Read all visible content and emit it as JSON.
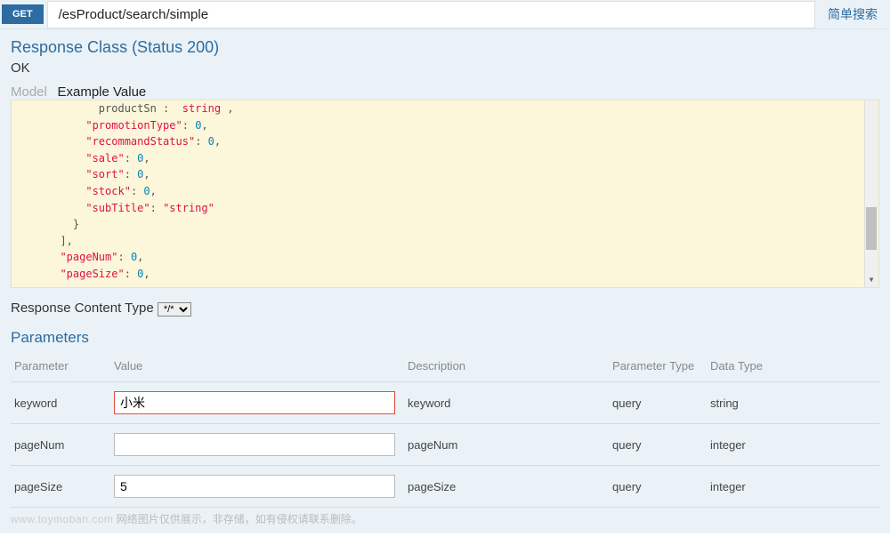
{
  "header": {
    "method": "GET",
    "path": "/esProduct/search/simple",
    "description": "简单搜索"
  },
  "response": {
    "class_label": "Response Class (Status 200)",
    "status_text": "OK"
  },
  "tabs": {
    "model": "Model",
    "example": "Example Value"
  },
  "example_json_prefix": "        productSn : ",
  "example_json": {
    "promotionType": 0,
    "recommandStatus": 0,
    "sale": 0,
    "sort": 0,
    "stock": 0,
    "subTitle": "string",
    "pageNum": 0,
    "pageSize": 0
  },
  "content_type": {
    "label": "Response Content Type",
    "value": "*/* "
  },
  "parameters": {
    "title": "Parameters",
    "headers": {
      "parameter": "Parameter",
      "value": "Value",
      "description": "Description",
      "param_type": "Parameter Type",
      "data_type": "Data Type"
    },
    "rows": [
      {
        "name": "keyword",
        "value": "小米",
        "description": "keyword",
        "param_type": "query",
        "data_type": "string",
        "highlight": true
      },
      {
        "name": "pageNum",
        "value": "",
        "description": "pageNum",
        "param_type": "query",
        "data_type": "integer",
        "highlight": false
      },
      {
        "name": "pageSize",
        "value": "5",
        "description": "pageSize",
        "param_type": "query",
        "data_type": "integer",
        "highlight": false
      }
    ]
  },
  "watermark": {
    "site": "www.toymoban.com",
    "text": "网络图片仅供展示，非存储，如有侵权请联系删除。"
  }
}
